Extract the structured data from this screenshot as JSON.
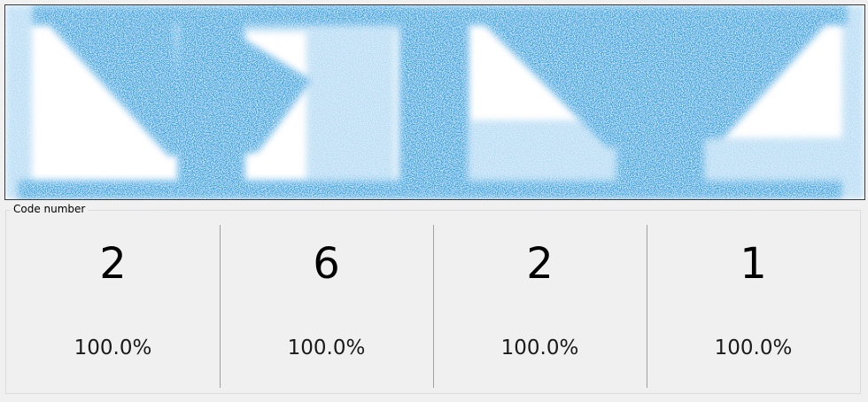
{
  "capture_image": {
    "description_icon": "captured-barcode-image",
    "ink_color": "#1ea4e2",
    "background_color": "#ffffff"
  },
  "group": {
    "title": "Code number"
  },
  "results": [
    {
      "digit": "2",
      "confidence": "100.0%"
    },
    {
      "digit": "6",
      "confidence": "100.0%"
    },
    {
      "digit": "2",
      "confidence": "100.0%"
    },
    {
      "digit": "1",
      "confidence": "100.0%"
    }
  ]
}
